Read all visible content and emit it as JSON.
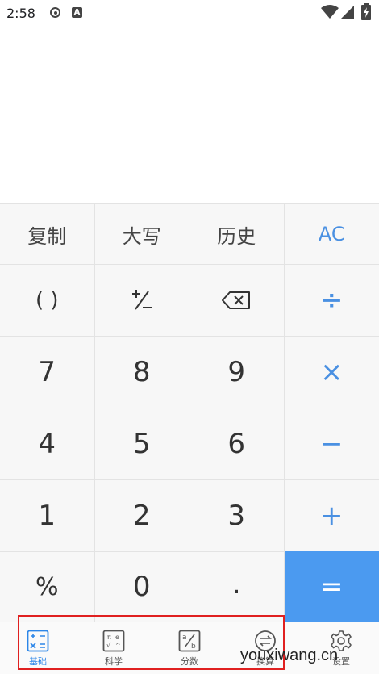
{
  "status_bar": {
    "time": "2:58",
    "a_badge": "A",
    "icons": [
      "record-icon",
      "a-notification-icon",
      "wifi-icon",
      "signal-icon",
      "battery-icon"
    ]
  },
  "keypad": {
    "row1": [
      "复制",
      "大写",
      "历史",
      "AC"
    ],
    "row2": [
      "( )",
      "+/-",
      "backspace",
      "÷"
    ],
    "row3": [
      "7",
      "8",
      "9",
      "×"
    ],
    "row4": [
      "4",
      "5",
      "6",
      "−"
    ],
    "row5": [
      "1",
      "2",
      "3",
      "+"
    ],
    "row6": [
      "%",
      "0",
      ".",
      "="
    ]
  },
  "tabs": [
    {
      "label": "基础",
      "icon": "basic-calc-icon",
      "active": true
    },
    {
      "label": "科学",
      "icon": "scientific-icon",
      "active": false
    },
    {
      "label": "分数",
      "icon": "fraction-icon",
      "active": false
    },
    {
      "label": "换算",
      "icon": "convert-icon",
      "active": false
    },
    {
      "label": "设置",
      "icon": "settings-gear-icon",
      "active": false
    }
  ],
  "watermark": "youxiwang.cn",
  "colors": {
    "accent": "#4a90e2",
    "equals_bg": "#4b9af0",
    "key_bg": "#f7f7f7",
    "highlight_box": "#e02020"
  }
}
